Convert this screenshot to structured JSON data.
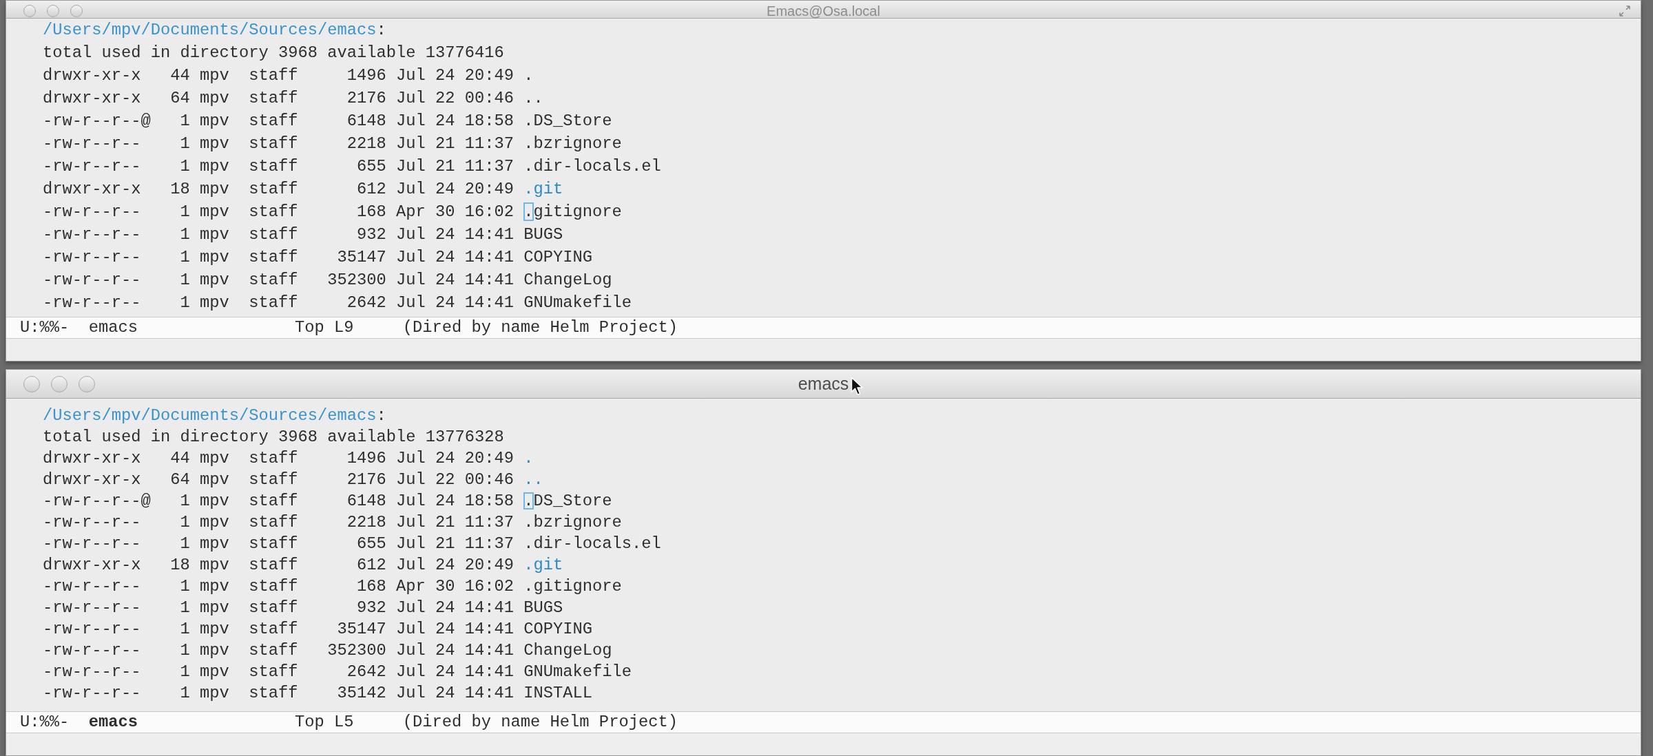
{
  "windows": [
    {
      "title": "Emacs@Osa.local",
      "active": false,
      "header": {
        "path": "/Users/mpv/Documents/Sources/emacs",
        "suffix": ":"
      },
      "summary": "total used in directory 3968 available 13776416",
      "entries": [
        {
          "permissions": "drwxr-xr-x",
          "links": "44",
          "owner": "mpv",
          "group": "staff",
          "size": "1496",
          "date": "Jul 24 20:49",
          "name": ".",
          "color": "#2e2e2e",
          "cursor": false
        },
        {
          "permissions": "drwxr-xr-x",
          "links": "64",
          "owner": "mpv",
          "group": "staff",
          "size": "2176",
          "date": "Jul 22 00:46",
          "name": "..",
          "color": "#2e2e2e",
          "cursor": false
        },
        {
          "permissions": "-rw-r--r--@",
          "links": "1",
          "owner": "mpv",
          "group": "staff",
          "size": "6148",
          "date": "Jul 24 18:58",
          "name": ".DS_Store",
          "color": "#2e2e2e",
          "cursor": false
        },
        {
          "permissions": "-rw-r--r--",
          "links": "1",
          "owner": "mpv",
          "group": "staff",
          "size": "2218",
          "date": "Jul 21 11:37",
          "name": ".bzrignore",
          "color": "#2e2e2e",
          "cursor": false
        },
        {
          "permissions": "-rw-r--r--",
          "links": "1",
          "owner": "mpv",
          "group": "staff",
          "size": "655",
          "date": "Jul 21 11:37",
          "name": ".dir-locals.el",
          "color": "#2e2e2e",
          "cursor": false
        },
        {
          "permissions": "drwxr-xr-x",
          "links": "18",
          "owner": "mpv",
          "group": "staff",
          "size": "612",
          "date": "Jul 24 20:49",
          "name": ".git",
          "color": "#2b8ac6",
          "cursor": false
        },
        {
          "permissions": "-rw-r--r--",
          "links": "1",
          "owner": "mpv",
          "group": "staff",
          "size": "168",
          "date": "Apr 30 16:02",
          "name": ".gitignore",
          "color": "#2e2e2e",
          "cursor": true
        },
        {
          "permissions": "-rw-r--r--",
          "links": "1",
          "owner": "mpv",
          "group": "staff",
          "size": "932",
          "date": "Jul 24 14:41",
          "name": "BUGS",
          "color": "#2e2e2e",
          "cursor": false
        },
        {
          "permissions": "-rw-r--r--",
          "links": "1",
          "owner": "mpv",
          "group": "staff",
          "size": "35147",
          "date": "Jul 24 14:41",
          "name": "COPYING",
          "color": "#2e2e2e",
          "cursor": false
        },
        {
          "permissions": "-rw-r--r--",
          "links": "1",
          "owner": "mpv",
          "group": "staff",
          "size": "352300",
          "date": "Jul 24 14:41",
          "name": "ChangeLog",
          "color": "#2e2e2e",
          "cursor": false
        },
        {
          "permissions": "-rw-r--r--",
          "links": "1",
          "owner": "mpv",
          "group": "staff",
          "size": "2642",
          "date": "Jul 24 14:41",
          "name": "GNUmakefile",
          "color": "#2e2e2e",
          "cursor": false
        }
      ],
      "mode_line": {
        "status": "U:%%-",
        "buffer": "emacs",
        "position": "Top L9",
        "modes": "(Dired by name Helm Project)"
      }
    },
    {
      "title": "emacs",
      "active": true,
      "header": {
        "path": "/Users/mpv/Documents/Sources/emacs",
        "suffix": ":"
      },
      "summary": "total used in directory 3968 available 13776328",
      "entries": [
        {
          "permissions": "drwxr-xr-x",
          "links": "44",
          "owner": "mpv",
          "group": "staff",
          "size": "1496",
          "date": "Jul 24 20:49",
          "name": ".",
          "color": "#2b8ac6",
          "cursor": false
        },
        {
          "permissions": "drwxr-xr-x",
          "links": "64",
          "owner": "mpv",
          "group": "staff",
          "size": "2176",
          "date": "Jul 22 00:46",
          "name": "..",
          "color": "#2b8ac6",
          "cursor": false
        },
        {
          "permissions": "-rw-r--r--@",
          "links": "1",
          "owner": "mpv",
          "group": "staff",
          "size": "6148",
          "date": "Jul 24 18:58",
          "name": ".DS_Store",
          "color": "#2e2e2e",
          "cursor": true
        },
        {
          "permissions": "-rw-r--r--",
          "links": "1",
          "owner": "mpv",
          "group": "staff",
          "size": "2218",
          "date": "Jul 21 11:37",
          "name": ".bzrignore",
          "color": "#2e2e2e",
          "cursor": false
        },
        {
          "permissions": "-rw-r--r--",
          "links": "1",
          "owner": "mpv",
          "group": "staff",
          "size": "655",
          "date": "Jul 21 11:37",
          "name": ".dir-locals.el",
          "color": "#2e2e2e",
          "cursor": false
        },
        {
          "permissions": "drwxr-xr-x",
          "links": "18",
          "owner": "mpv",
          "group": "staff",
          "size": "612",
          "date": "Jul 24 20:49",
          "name": ".git",
          "color": "#2b8ac6",
          "cursor": false
        },
        {
          "permissions": "-rw-r--r--",
          "links": "1",
          "owner": "mpv",
          "group": "staff",
          "size": "168",
          "date": "Apr 30 16:02",
          "name": ".gitignore",
          "color": "#2e2e2e",
          "cursor": false
        },
        {
          "permissions": "-rw-r--r--",
          "links": "1",
          "owner": "mpv",
          "group": "staff",
          "size": "932",
          "date": "Jul 24 14:41",
          "name": "BUGS",
          "color": "#2e2e2e",
          "cursor": false
        },
        {
          "permissions": "-rw-r--r--",
          "links": "1",
          "owner": "mpv",
          "group": "staff",
          "size": "35147",
          "date": "Jul 24 14:41",
          "name": "COPYING",
          "color": "#2e2e2e",
          "cursor": false
        },
        {
          "permissions": "-rw-r--r--",
          "links": "1",
          "owner": "mpv",
          "group": "staff",
          "size": "352300",
          "date": "Jul 24 14:41",
          "name": "ChangeLog",
          "color": "#2e2e2e",
          "cursor": false
        },
        {
          "permissions": "-rw-r--r--",
          "links": "1",
          "owner": "mpv",
          "group": "staff",
          "size": "2642",
          "date": "Jul 24 14:41",
          "name": "GNUmakefile",
          "color": "#2e2e2e",
          "cursor": false
        },
        {
          "permissions": "-rw-r--r--",
          "links": "1",
          "owner": "mpv",
          "group": "staff",
          "size": "35142",
          "date": "Jul 24 14:41",
          "name": "INSTALL",
          "color": "#2e2e2e",
          "cursor": false
        }
      ],
      "mode_line": {
        "status": "U:%%-",
        "buffer": "emacs",
        "position": "Top L5",
        "modes": "(Dired by name Helm Project)"
      }
    }
  ]
}
